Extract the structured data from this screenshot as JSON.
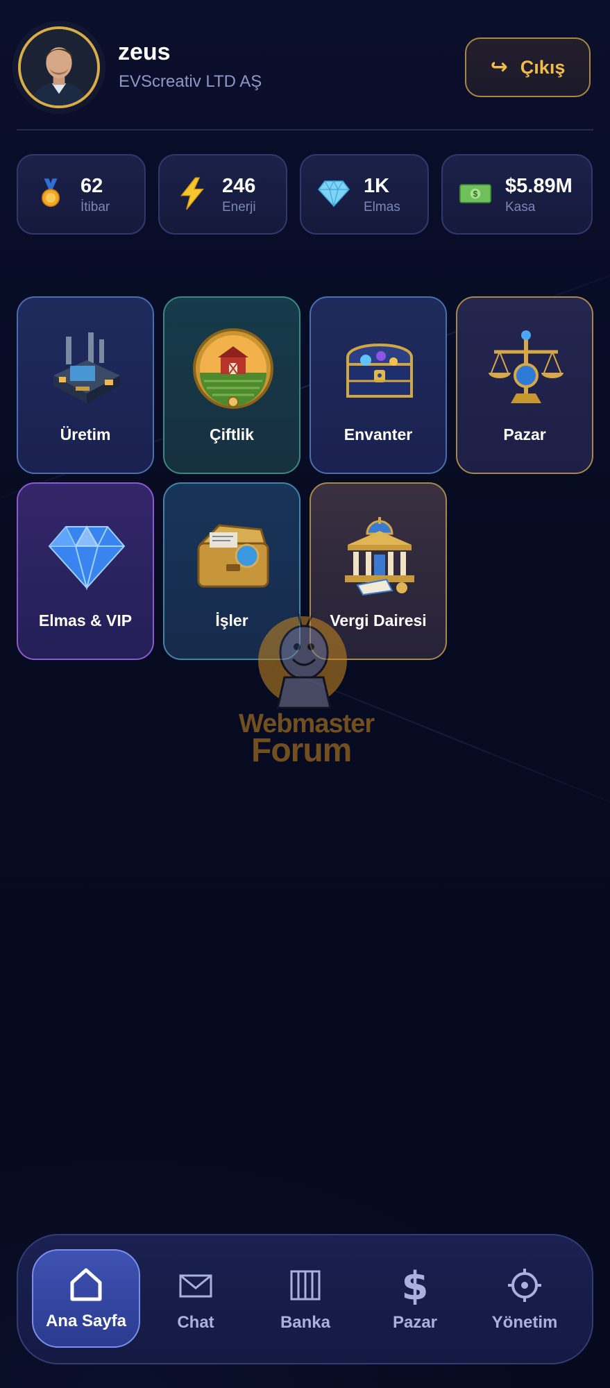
{
  "header": {
    "username": "zeus",
    "company": "EVScreativ LTD AŞ",
    "logout_label": "Çıkış"
  },
  "stats": [
    {
      "icon": "medal-icon",
      "value": "62",
      "label": "İtibar"
    },
    {
      "icon": "lightning-icon",
      "value": "246",
      "label": "Enerji"
    },
    {
      "icon": "diamond-icon",
      "value": "1K",
      "label": "Elmas"
    },
    {
      "icon": "money-icon",
      "value": "$5.89M",
      "label": "Kasa"
    }
  ],
  "tiles": [
    {
      "label": "Üretim",
      "icon": "factory-icon"
    },
    {
      "label": "Çiftlik",
      "icon": "farm-icon"
    },
    {
      "label": "Envanter",
      "icon": "treasure-chest-icon"
    },
    {
      "label": "Pazar",
      "icon": "scales-icon"
    },
    {
      "label": "Elmas & VIP",
      "icon": "diamond-icon"
    },
    {
      "label": "İşler",
      "icon": "briefcase-icon"
    },
    {
      "label": "Vergi Dairesi",
      "icon": "tax-office-icon"
    }
  ],
  "watermark": {
    "line1": "Webmaster",
    "line2": "Forum"
  },
  "nav": [
    {
      "label": "Ana Sayfa",
      "icon": "home-icon",
      "active": true
    },
    {
      "label": "Chat",
      "icon": "envelope-icon",
      "active": false
    },
    {
      "label": "Banka",
      "icon": "bank-icon",
      "active": false
    },
    {
      "label": "Pazar",
      "icon": "dollar-icon",
      "active": false
    },
    {
      "label": "Yönetim",
      "icon": "gear-icon",
      "active": false
    }
  ],
  "colors": {
    "background": "#070b22",
    "accent_gold": "#f2bb4a",
    "active_nav": "#3e52b3",
    "muted_text": "#8f97c6"
  }
}
